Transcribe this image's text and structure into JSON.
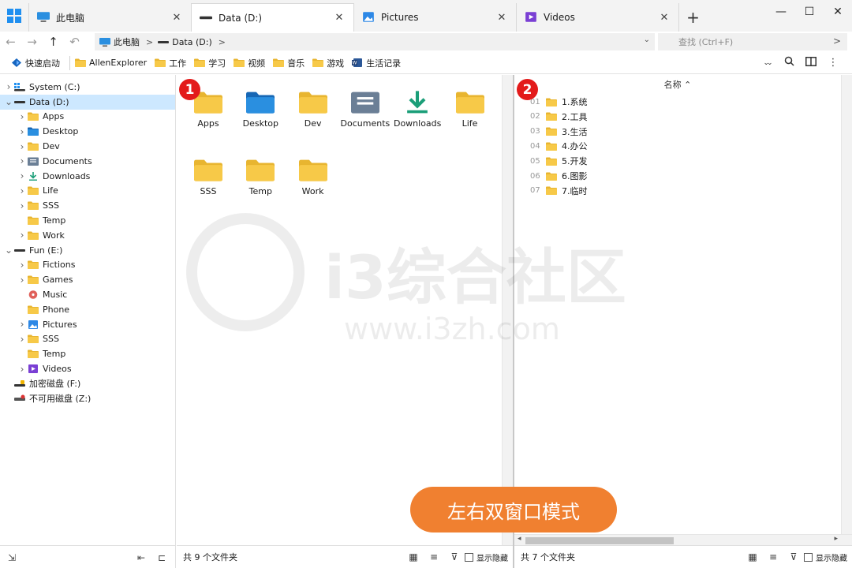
{
  "tabs": [
    {
      "label": "此电脑",
      "icon": "monitor-icon",
      "active": false
    },
    {
      "label": "Data (D:)",
      "icon": "drive-icon",
      "active": true
    },
    {
      "label": "Pictures",
      "icon": "pictures-icon",
      "active": false
    },
    {
      "label": "Videos",
      "icon": "videos-icon",
      "active": false
    }
  ],
  "tab_close": "✕",
  "add_tab": "+",
  "window_controls": {
    "minimize": "—",
    "maximize": "☐",
    "close": "✕"
  },
  "nav": {
    "back": "←",
    "forward": "→",
    "up": "↑",
    "undo": "↶"
  },
  "breadcrumb": [
    {
      "label": "此电脑",
      "sep": ">"
    },
    {
      "label": "Data (D:)",
      "sep": ">"
    }
  ],
  "addr_dropdown": "⌄",
  "search": {
    "placeholder": "查找 (Ctrl+F)",
    "go": ">"
  },
  "bookmarks": [
    {
      "label": "快速启动",
      "icon": "quick-launch-icon"
    },
    {
      "label": "AllenExplorer",
      "icon": "folder-icon"
    },
    {
      "label": "工作",
      "icon": "folder-icon"
    },
    {
      "label": "学习",
      "icon": "folder-icon"
    },
    {
      "label": "视频",
      "icon": "folder-icon"
    },
    {
      "label": "音乐",
      "icon": "folder-icon"
    },
    {
      "label": "游戏",
      "icon": "folder-icon"
    },
    {
      "label": "生活记录",
      "icon": "word-doc-icon"
    }
  ],
  "toolbar": {
    "expand": "⌄⌄",
    "search": "🔍",
    "dual_pane": "◫",
    "more": "⋮"
  },
  "tree": [
    {
      "label": "System (C:)",
      "level": 0,
      "chevron": ">",
      "icon": "system-drive-icon",
      "selected": false
    },
    {
      "label": "Data (D:)",
      "level": 0,
      "chevron": "v",
      "icon": "drive-icon",
      "selected": true
    },
    {
      "label": "Apps",
      "level": 1,
      "chevron": ">",
      "icon": "folder-icon",
      "selected": false
    },
    {
      "label": "Desktop",
      "level": 1,
      "chevron": ">",
      "icon": "desktop-folder-icon",
      "selected": false
    },
    {
      "label": "Dev",
      "level": 1,
      "chevron": ">",
      "icon": "folder-icon",
      "selected": false
    },
    {
      "label": "Documents",
      "level": 1,
      "chevron": ">",
      "icon": "documents-icon",
      "selected": false
    },
    {
      "label": "Downloads",
      "level": 1,
      "chevron": ">",
      "icon": "downloads-icon",
      "selected": false
    },
    {
      "label": "Life",
      "level": 1,
      "chevron": ">",
      "icon": "folder-icon",
      "selected": false
    },
    {
      "label": "SSS",
      "level": 1,
      "chevron": ">",
      "icon": "folder-icon",
      "selected": false
    },
    {
      "label": "Temp",
      "level": 1,
      "chevron": "",
      "icon": "folder-icon",
      "selected": false
    },
    {
      "label": "Work",
      "level": 1,
      "chevron": ">",
      "icon": "folder-icon",
      "selected": false
    },
    {
      "label": "Fun (E:)",
      "level": 0,
      "chevron": "v",
      "icon": "drive-icon",
      "selected": false
    },
    {
      "label": "Fictions",
      "level": 1,
      "chevron": ">",
      "icon": "folder-icon",
      "selected": false
    },
    {
      "label": "Games",
      "level": 1,
      "chevron": ">",
      "icon": "folder-icon",
      "selected": false
    },
    {
      "label": "Music",
      "level": 1,
      "chevron": "",
      "icon": "music-icon",
      "selected": false
    },
    {
      "label": "Phone",
      "level": 1,
      "chevron": "",
      "icon": "folder-icon",
      "selected": false
    },
    {
      "label": "Pictures",
      "level": 1,
      "chevron": ">",
      "icon": "pictures-icon",
      "selected": false
    },
    {
      "label": "SSS",
      "level": 1,
      "chevron": ">",
      "icon": "folder-icon",
      "selected": false
    },
    {
      "label": "Temp",
      "level": 1,
      "chevron": "",
      "icon": "folder-icon",
      "selected": false
    },
    {
      "label": "Videos",
      "level": 1,
      "chevron": ">",
      "icon": "videos-icon",
      "selected": false
    },
    {
      "label": "加密磁盘 (F:)",
      "level": 0,
      "chevron": "",
      "icon": "encrypted-drive-icon",
      "selected": false
    },
    {
      "label": "不可用磁盘 (Z:)",
      "level": 0,
      "chevron": "",
      "icon": "unavailable-drive-icon",
      "selected": false
    }
  ],
  "sidebar_tools": {
    "collapse": "⇲",
    "outdent": "⇤",
    "tree": "⊏"
  },
  "pane1": {
    "badge": "1",
    "items": [
      {
        "label": "Apps",
        "icon": "folder-icon"
      },
      {
        "label": "Desktop",
        "icon": "desktop-folder-icon"
      },
      {
        "label": "Dev",
        "icon": "folder-icon"
      },
      {
        "label": "Documents",
        "icon": "documents-icon"
      },
      {
        "label": "Downloads",
        "icon": "downloads-icon"
      },
      {
        "label": "Life",
        "icon": "folder-icon"
      },
      {
        "label": "SSS",
        "icon": "folder-icon"
      },
      {
        "label": "Temp",
        "icon": "folder-icon"
      },
      {
        "label": "Work",
        "icon": "folder-icon"
      }
    ],
    "status": "共 9 个文件夹",
    "show_hidden": "显示隐藏"
  },
  "pane2": {
    "badge": "2",
    "column_header": "名称 ⌃",
    "rows": [
      {
        "num": "01",
        "label": "1.系统"
      },
      {
        "num": "02",
        "label": "2.工具"
      },
      {
        "num": "03",
        "label": "3.生活"
      },
      {
        "num": "04",
        "label": "4.办公"
      },
      {
        "num": "05",
        "label": "5.开发"
      },
      {
        "num": "06",
        "label": "6.图影"
      },
      {
        "num": "07",
        "label": "7.临时"
      }
    ],
    "status": "共 7 个文件夹",
    "show_hidden": "显示隐藏",
    "scroll_left": "◂",
    "scroll_right": "▸"
  },
  "status_tools": {
    "view": "▦",
    "sort": "≡",
    "filter": "⊽"
  },
  "watermark": {
    "title": "i3综合社区",
    "url": "www.i3zh.com"
  },
  "overlay_label": "左右双窗口模式",
  "colors": {
    "folder": "#f7c948",
    "folder_dark": "#e8b530",
    "selection": "#cde8ff",
    "badge": "#e31b1b",
    "overlay": "#f08030",
    "accent": "#1f8ff0"
  }
}
